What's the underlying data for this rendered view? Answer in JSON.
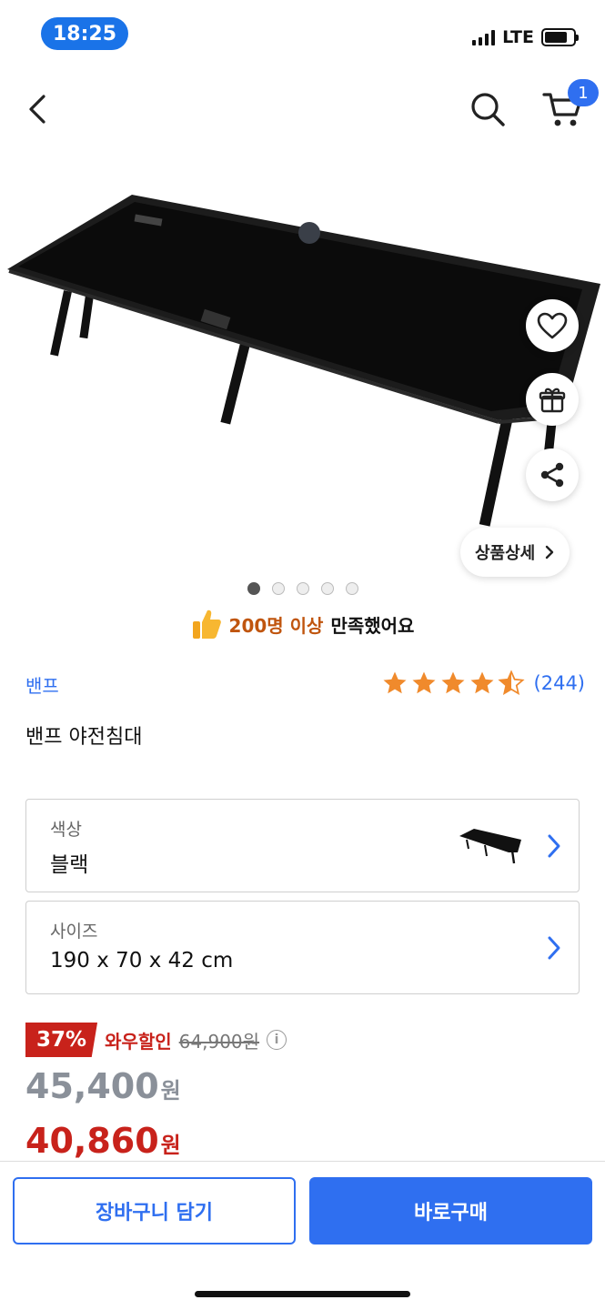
{
  "status": {
    "time": "18:25",
    "network": "LTE"
  },
  "nav": {
    "cart_count": "1"
  },
  "icons": {
    "back": "chevron-left-icon",
    "search": "search-icon",
    "cart": "cart-icon",
    "heart": "heart-icon",
    "gift": "gift-icon",
    "share": "share-icon",
    "thumbs_up": "thumbs-up-icon",
    "info": "info-icon"
  },
  "gallery": {
    "detail_label": "상품상세",
    "image_count": 5,
    "active_index": 0
  },
  "satisfaction": {
    "highlight": "200명 이상",
    "text": "만족했어요"
  },
  "product": {
    "brand": "밴프",
    "title": "밴프 야전침대",
    "rating": 4.5,
    "review_count": "(244)"
  },
  "options": [
    {
      "label": "색상",
      "value": "블랙"
    },
    {
      "label": "사이즈",
      "value": "190 x 70 x 42 cm"
    }
  ],
  "pricing": {
    "discount_pct": "37%",
    "discount_label": "와우할인",
    "original_price": "64,900원",
    "info_glyph": "i",
    "price": "45,400",
    "wow_price": "40,860",
    "currency": "원"
  },
  "actions": {
    "add_to_cart": "장바구니 담기",
    "buy_now": "바로구매"
  },
  "colors": {
    "accent": "#2f6ff0",
    "sale": "#c8221b",
    "time_pill": "#1a73e8"
  }
}
